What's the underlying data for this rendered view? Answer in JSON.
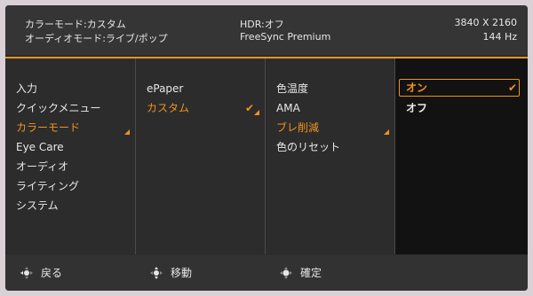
{
  "info": {
    "color_mode": "カラーモード:カスタム",
    "audio_mode": "オーディオモード:ライブ/ポップ",
    "hdr": "HDR:オフ",
    "freesync": "FreeSync Premium",
    "resolution": "3840 X 2160",
    "refresh": "144 Hz"
  },
  "menu1": {
    "items": [
      {
        "label": "入力"
      },
      {
        "label": "クイックメニュー"
      },
      {
        "label": "カラーモード"
      },
      {
        "label": "Eye Care"
      },
      {
        "label": "オーディオ"
      },
      {
        "label": "ライティング"
      },
      {
        "label": "システム"
      }
    ]
  },
  "menu2": {
    "items": [
      {
        "label": "ePaper"
      },
      {
        "label": "カスタム"
      }
    ]
  },
  "menu3": {
    "items": [
      {
        "label": "色温度"
      },
      {
        "label": "AMA"
      },
      {
        "label": "ブレ削減"
      },
      {
        "label": "色のリセット"
      }
    ]
  },
  "menu4": {
    "items": [
      {
        "label": "オン"
      },
      {
        "label": "オフ"
      }
    ]
  },
  "footer": {
    "back": "戻る",
    "move": "移動",
    "confirm": "確定"
  },
  "colors": {
    "accent": "#f2931e",
    "panel": "#2c2c2c",
    "selected_column": "#121212"
  },
  "icons": {
    "check": "check-icon",
    "submenu": "submenu-arrow-icon",
    "joystick": "joystick-icon"
  }
}
